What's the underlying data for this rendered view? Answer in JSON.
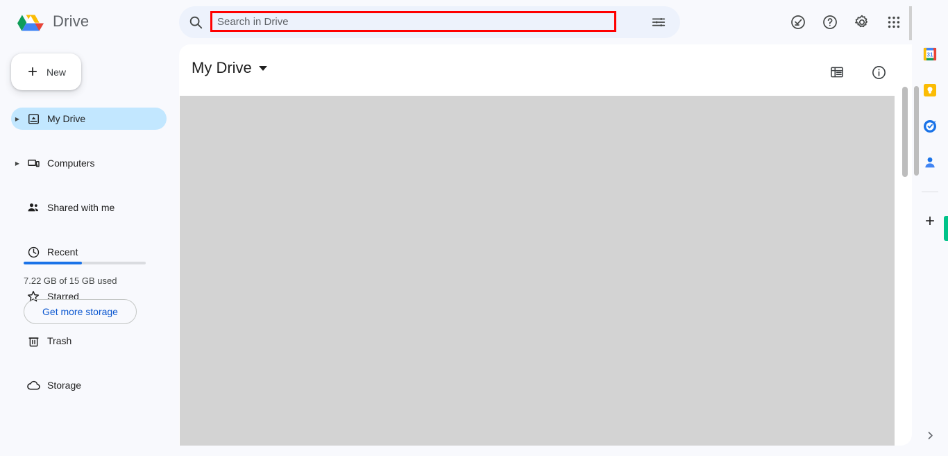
{
  "app": {
    "brand_name": "Drive",
    "logo_icon": "drive-logo-icon"
  },
  "search": {
    "placeholder": "Search in Drive",
    "value": "",
    "search_icon": "search-icon",
    "tune_icon": "tune-filter-icon",
    "highlight_color": "#ff0000"
  },
  "top_actions": [
    {
      "name": "tasks-status-icon",
      "label": "Support / status"
    },
    {
      "name": "help-icon",
      "label": "Help"
    },
    {
      "name": "settings-gear-icon",
      "label": "Settings"
    },
    {
      "name": "apps-grid-icon",
      "label": "Google apps"
    }
  ],
  "sidebar": {
    "new_button": {
      "label": "New",
      "icon": "plus-icon"
    },
    "items": [
      {
        "label": "My Drive",
        "icon": "my-drive-icon",
        "active": true,
        "expandable": true
      },
      {
        "label": "Computers",
        "icon": "computers-icon",
        "active": false,
        "expandable": true
      },
      {
        "label": "Shared with me",
        "icon": "shared-people-icon",
        "active": false,
        "expandable": false
      },
      {
        "label": "Recent",
        "icon": "clock-icon",
        "active": false,
        "expandable": false
      },
      {
        "label": "Starred",
        "icon": "star-icon",
        "active": false,
        "expandable": false
      },
      {
        "label": "Trash",
        "icon": "trash-icon",
        "active": false,
        "expandable": false
      },
      {
        "label": "Storage",
        "icon": "cloud-icon",
        "active": false,
        "expandable": false
      }
    ],
    "storage": {
      "used_text": "7.22 GB of 15 GB used",
      "percent": 48,
      "bar_color": "#1a73e8",
      "get_more_label": "Get more storage"
    }
  },
  "main": {
    "title": "My Drive",
    "title_caret_icon": "chevron-down-icon",
    "tools": [
      {
        "name": "list-view-icon",
        "label": "List layout"
      },
      {
        "name": "info-icon",
        "label": "View details"
      }
    ]
  },
  "rail": {
    "apps": [
      {
        "name": "google-calendar-icon",
        "label": "Calendar",
        "day": "31"
      },
      {
        "name": "google-keep-icon",
        "label": "Keep"
      },
      {
        "name": "google-tasks-icon",
        "label": "Tasks"
      },
      {
        "name": "google-contacts-icon",
        "label": "Contacts"
      }
    ],
    "add_label": "Get add-ons",
    "add_icon": "plus-icon",
    "expand_icon": "chevron-right-icon",
    "accent_color": "#00c389"
  }
}
